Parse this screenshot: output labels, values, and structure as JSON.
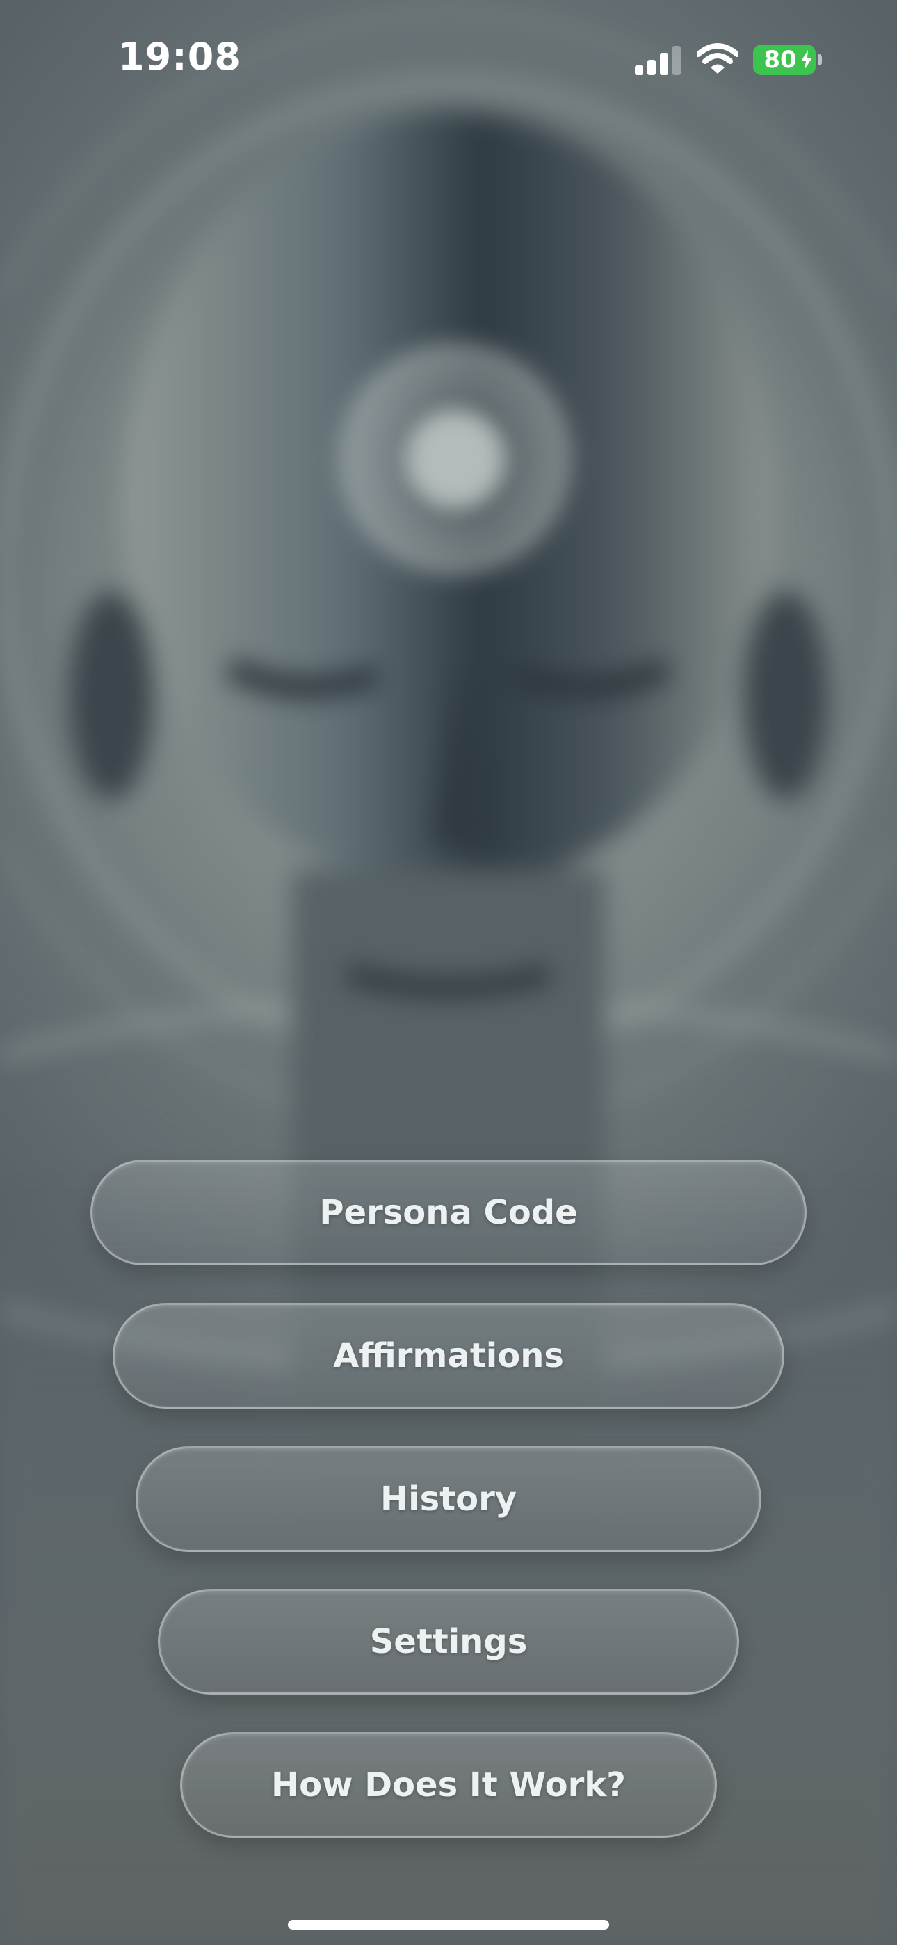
{
  "status_bar": {
    "time": "19:08",
    "battery_level": "80",
    "battery_color": "#3cc44f",
    "icons": [
      "signal-icon",
      "wifi-icon",
      "battery-icon",
      "charging-bolt-icon"
    ]
  },
  "background": {
    "description_icon": "meditating-face-illustration",
    "tint": "#7a8384"
  },
  "menu": {
    "items": [
      {
        "label": "Persona Code"
      },
      {
        "label": "Affirmations"
      },
      {
        "label": "History"
      },
      {
        "label": "Settings"
      },
      {
        "label": "How Does It Work?"
      }
    ]
  }
}
